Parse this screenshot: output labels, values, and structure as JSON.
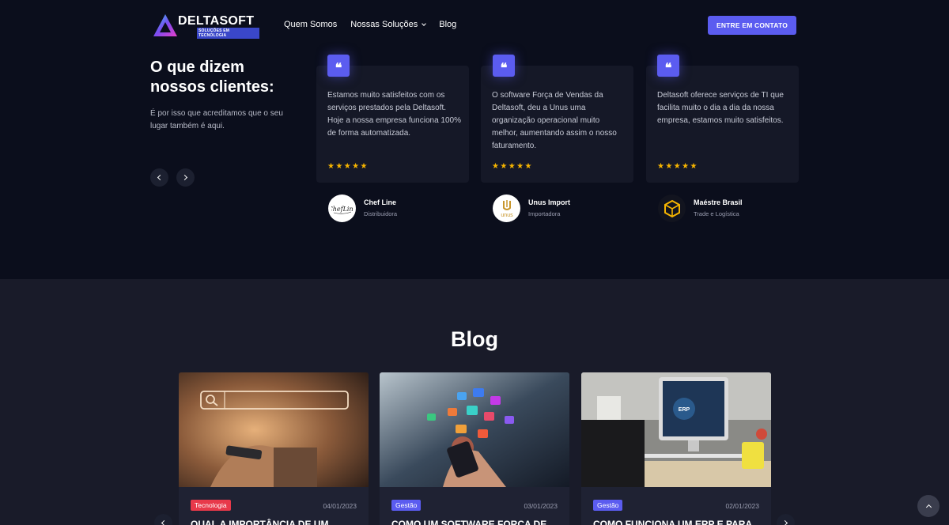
{
  "brand": {
    "name": "DELTASOFT",
    "tagline": "SOLUÇÕES EM TECNOLOGIA"
  },
  "nav": {
    "items": [
      "Quem Somos",
      "Nossas Soluções",
      "Blog"
    ],
    "cta": "ENTRE EM CONTATO"
  },
  "testimonials": {
    "heading_line1": "O que dizem",
    "heading_line2": "nossos clientes:",
    "lead": "É por isso que acreditamos que o seu lugar também é aqui.",
    "cards": [
      {
        "quote": "Estamos muito satisfeitos com os serviços prestados pela Deltasoft. Hoje a nossa empresa funciona 100% de forma automatizada.",
        "stars": 5,
        "client": "Chef Line",
        "role": "Distribuidora",
        "logo_icon": "chef-line-logo"
      },
      {
        "quote": "O software Força de Vendas da Deltasoft, deu a Unus uma organização operacional muito melhor, aumentando assim o nosso faturamento.",
        "stars": 5,
        "client": "Unus Import",
        "role": "Importadora",
        "logo_icon": "unus-logo"
      },
      {
        "quote": "Deltasoft oferece serviços de TI que facilita muito o dia a dia da nossa empresa, estamos muito satisfeitos.",
        "stars": 5,
        "client": "Maéstre Brasil",
        "role": "Trade e Logística",
        "logo_icon": "maestre-box-logo"
      }
    ]
  },
  "blog": {
    "title": "Blog",
    "posts": [
      {
        "tag": "Tecnologia",
        "tag_color": "#e8394a",
        "date": "04/01/2023",
        "headline": "QUAL A IMPORTÂNCIA DE UM"
      },
      {
        "tag": "Gestão",
        "tag_color": "#5b5cf0",
        "date": "03/01/2023",
        "headline": "COMO UM SOFTWARE FORÇA DE"
      },
      {
        "tag": "Gestão",
        "tag_color": "#5b5cf0",
        "date": "02/01/2023",
        "headline": "COMO FUNCIONA UM ERP E PARA"
      }
    ]
  },
  "colors": {
    "accent": "#5b5cf0",
    "background": "#0b0e1c",
    "star": "#f7b500"
  }
}
